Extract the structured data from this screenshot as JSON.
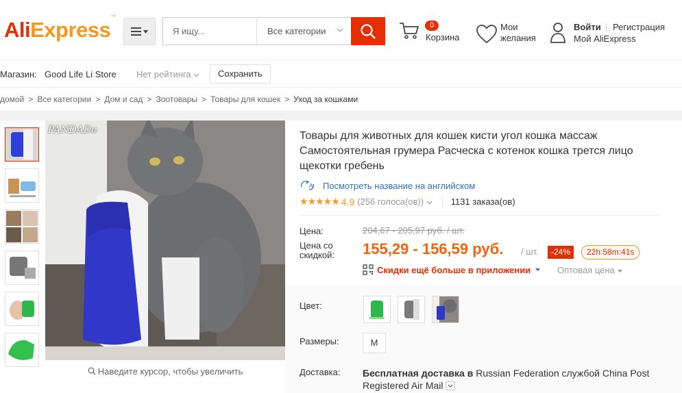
{
  "header": {
    "logo_left": "Ali",
    "logo_right": "Express",
    "logo_tm": "™",
    "search_placeholder": "Я ищу...",
    "category_select": "Все категории",
    "cart_count": "0",
    "cart_label": "Корзина",
    "wishlist_line1": "Мои",
    "wishlist_line2": "желания",
    "login_label": "Войти",
    "register_label": "Регистрация",
    "my_aliexpress": "Мой AliExpress"
  },
  "store": {
    "label": "Магазин:",
    "name": "Good Life Li Store",
    "rating": "Нет рейтинга",
    "save_button": "Сохранить"
  },
  "breadcrumb": [
    "домой",
    "Все категории",
    "Дом и сад",
    "Зоотовары",
    "Товары для кошек",
    "Уход за кошками"
  ],
  "gallery": {
    "watermark": "PANDADo",
    "zoom_hint": "Наведите курсор, чтобы увеличить",
    "thumbs_count": 6
  },
  "product": {
    "title": "Товары для животных для кошек кисти угол кошка массаж Самостоятельная грумера Расческа с котенок кошка трется лицо щекотки гребень",
    "translate_link": "Посмотреть название на английском",
    "rating_value": "4.9",
    "votes": "(256 голоса(ов))",
    "orders": "1131 заказа(ов)",
    "stars": 5
  },
  "pricing": {
    "price_label": "Цена:",
    "old_price": "204,67 - 205,97 руб. / шт.",
    "discount_label": "Цена со скидкой:",
    "new_price": "155,29 - 156,59 руб.",
    "unit": "/ шт.",
    "discount_badge": "-24%",
    "timer": "22h:58m:41s",
    "app_discount": "Скидки ещё больше в приложении",
    "wholesale": "Оптовая цена"
  },
  "options": {
    "color_label": "Цвет:",
    "colors": [
      "green",
      "gray",
      "photo"
    ],
    "size_label": "Размеры:",
    "sizes": [
      "M"
    ],
    "shipping_label": "Доставка:",
    "shipping_bold": "Бесплатная доставка в",
    "shipping_rest": "Russian Federation службой China Post Registered Air Mail"
  },
  "colors": {
    "brand_red": "#e62e04",
    "brand_orange": "#f7971e",
    "price_orange": "#f7630c",
    "link_blue": "#2f6fbd"
  }
}
